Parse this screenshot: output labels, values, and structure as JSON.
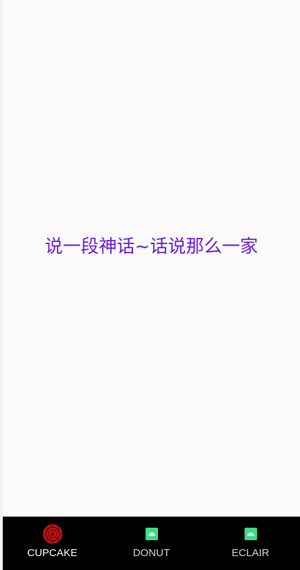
{
  "main": {
    "lyric_text": "说一段神话~话说那么一家"
  },
  "bottom_nav": {
    "items": [
      {
        "label": "CUPCAKE",
        "icon": "cupcake-badge-icon",
        "active": true
      },
      {
        "label": "DONUT",
        "icon": "android-icon",
        "active": false
      },
      {
        "label": "ECLAIR",
        "icon": "android-icon",
        "active": false
      }
    ]
  },
  "colors": {
    "lyric": "#6a1ad6",
    "nav_background": "#000000",
    "cupcake_icon": "#c0151a",
    "android_icon": "#3ddc84"
  }
}
